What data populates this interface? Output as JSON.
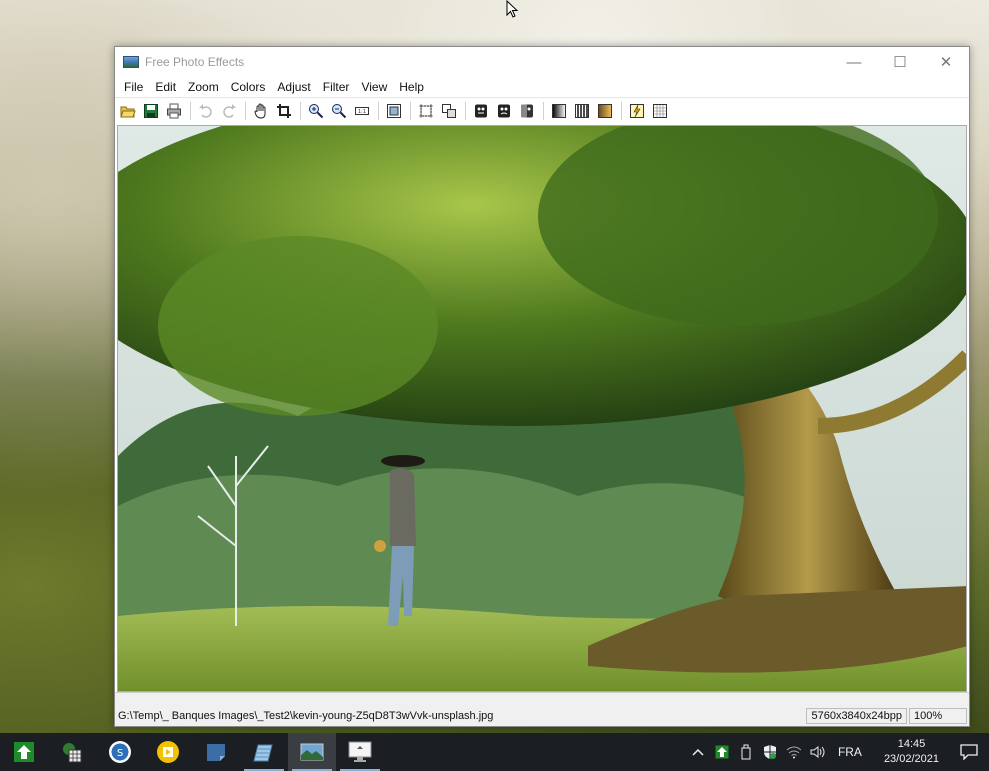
{
  "window": {
    "title": "Free Photo Effects",
    "controls": {
      "minimize": "—",
      "maximize": "☐",
      "close": "✕"
    }
  },
  "menu": {
    "items": [
      "File",
      "Edit",
      "Zoom",
      "Colors",
      "Adjust",
      "Filter",
      "View",
      "Help"
    ]
  },
  "toolbar": {
    "icons": [
      "open-icon",
      "save-icon",
      "print-icon",
      "undo-icon",
      "redo-icon",
      "hand-icon",
      "crop-icon",
      "zoom-in-icon",
      "zoom-out-icon",
      "actual-size-icon",
      "fit-window-icon",
      "select-icon",
      "resize-icon",
      "mask-icon",
      "mask-2-icon",
      "mask-3-icon",
      "gradient-icon",
      "bars-icon",
      "sepia-icon",
      "effect-icon",
      "grid-icon"
    ]
  },
  "status": {
    "path": "G:\\Temp\\_ Banques Images\\_Test2\\kevin-young-Z5qD8T3wVvk-unsplash.jpg",
    "dimensions": "5760x3840x24bpp",
    "zoom": "100%"
  },
  "taskbar": {
    "apps": [
      "home-app-icon",
      "excel-app-icon",
      "sync-app-icon",
      "media-app-icon",
      "notes-app-icon",
      "pencil-app-icon",
      "photo-effects-app-icon",
      "display-app-icon"
    ],
    "tray": {
      "language": "FRA",
      "time": "14:45",
      "date": "23/02/2021"
    }
  },
  "colors": {
    "taskbar_bg": "#1b1e22",
    "active_underline": "#8db1d6"
  }
}
